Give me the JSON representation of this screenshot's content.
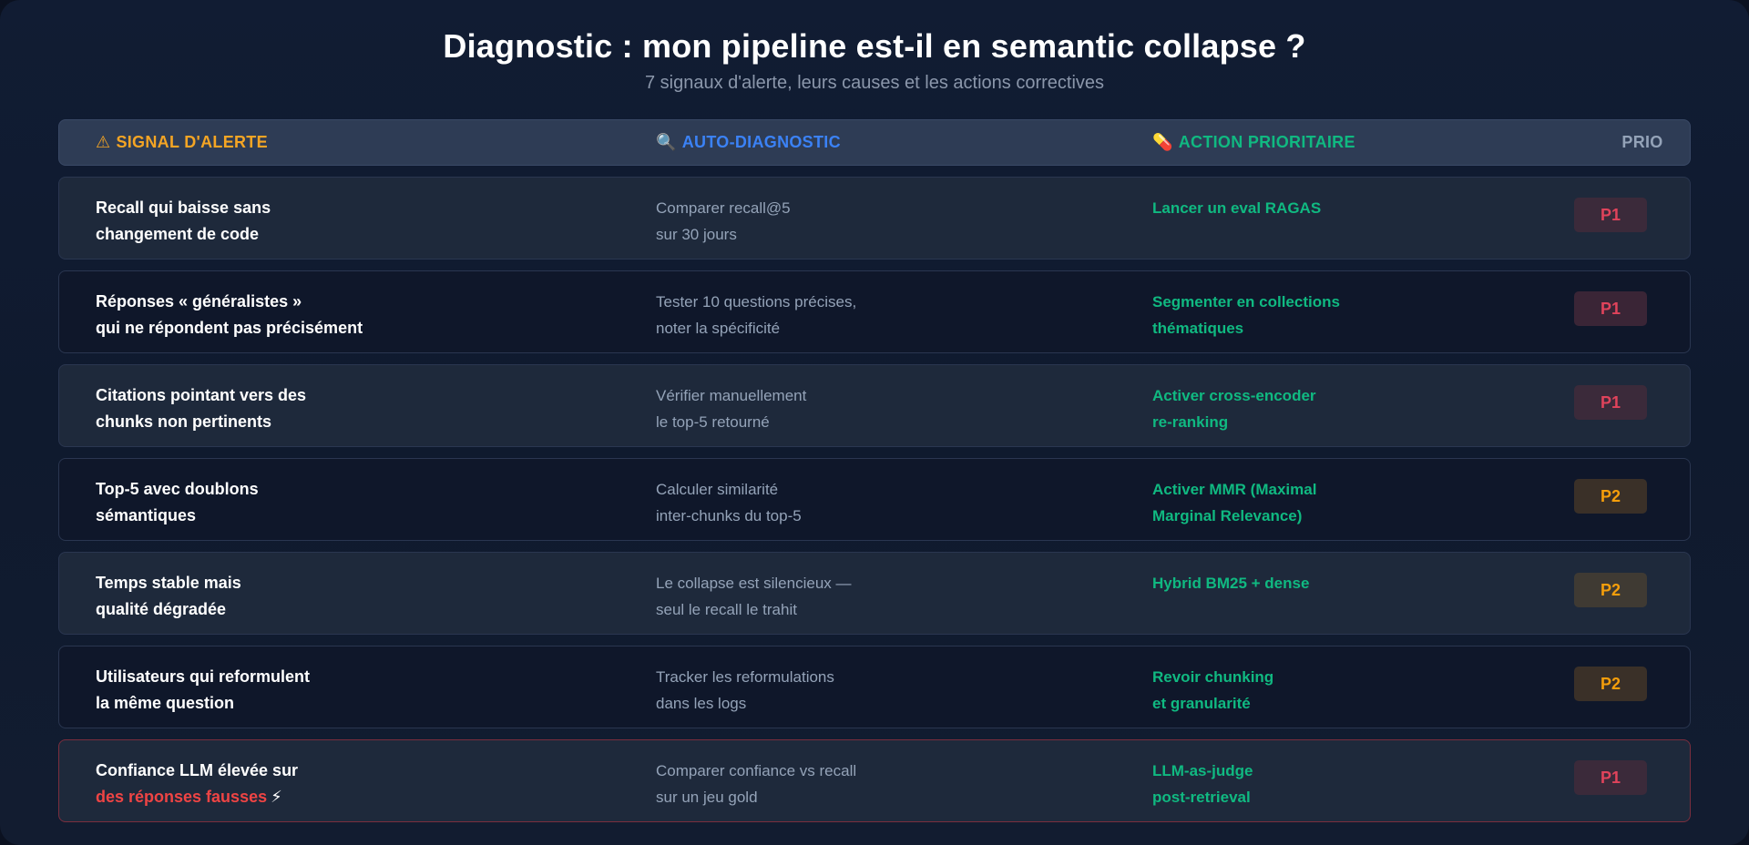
{
  "header": {
    "title": "Diagnostic : mon pipeline est-il en semantic collapse ?",
    "subtitle": "7 signaux d'alerte, leurs causes et les actions correctives"
  },
  "columns": {
    "signal": {
      "icon": "⚠",
      "label": "SIGNAL D'ALERTE",
      "icon_name": "warning-icon"
    },
    "diagnostic": {
      "icon": "🔍",
      "label": "AUTO-DIAGNOSTIC",
      "icon_name": "magnifier-icon"
    },
    "action": {
      "icon": "💊",
      "label": "ACTION PRIORITAIRE",
      "icon_name": "pill-icon"
    },
    "priority": {
      "label": "PRIO"
    }
  },
  "rows": [
    {
      "signal": [
        "Recall qui baisse sans",
        "changement de code"
      ],
      "diagnostic": [
        "Comparer recall@5",
        "sur 30 jours"
      ],
      "action": [
        "Lancer un eval RAGAS"
      ],
      "priority": "P1"
    },
    {
      "signal": [
        "Réponses « généralistes »",
        "qui ne répondent pas précisément"
      ],
      "diagnostic": [
        "Tester 10 questions précises,",
        "noter la spécificité"
      ],
      "action": [
        "Segmenter en collections",
        "thématiques"
      ],
      "priority": "P1"
    },
    {
      "signal": [
        "Citations pointant vers des",
        "chunks non pertinents"
      ],
      "diagnostic": [
        "Vérifier manuellement",
        "le top-5 retourné"
      ],
      "action": [
        "Activer cross-encoder",
        "re-ranking"
      ],
      "priority": "P1"
    },
    {
      "signal": [
        "Top-5 avec doublons",
        "sémantiques"
      ],
      "diagnostic": [
        "Calculer similarité",
        "inter-chunks du top-5"
      ],
      "action": [
        "Activer MMR (Maximal",
        "Marginal Relevance)"
      ],
      "priority": "P2"
    },
    {
      "signal": [
        "Temps stable mais",
        "qualité dégradée"
      ],
      "diagnostic": [
        "Le collapse est silencieux —",
        "seul le recall le trahit"
      ],
      "action": [
        "Hybrid BM25 + dense"
      ],
      "priority": "P2"
    },
    {
      "signal": [
        "Utilisateurs qui reformulent",
        "la même question"
      ],
      "diagnostic": [
        "Tracker les reformulations",
        "dans les logs"
      ],
      "action": [
        "Revoir chunking",
        "et granularité"
      ],
      "priority": "P2"
    },
    {
      "signal": [
        "Confiance LLM élevée sur",
        "des réponses fausses"
      ],
      "signal_icon": "⚡",
      "diagnostic": [
        "Comparer confiance vs recall",
        "sur un jeu gold"
      ],
      "action": [
        "LLM-as-judge",
        "post-retrieval"
      ],
      "priority": "P1"
    }
  ],
  "colors": {
    "signal_header": "#f5a524",
    "diagnostic_header": "#3b82f6",
    "action": "#10b981",
    "p1": "#e0435b",
    "p2": "#f59e0b",
    "danger_text": "#ef4444"
  }
}
